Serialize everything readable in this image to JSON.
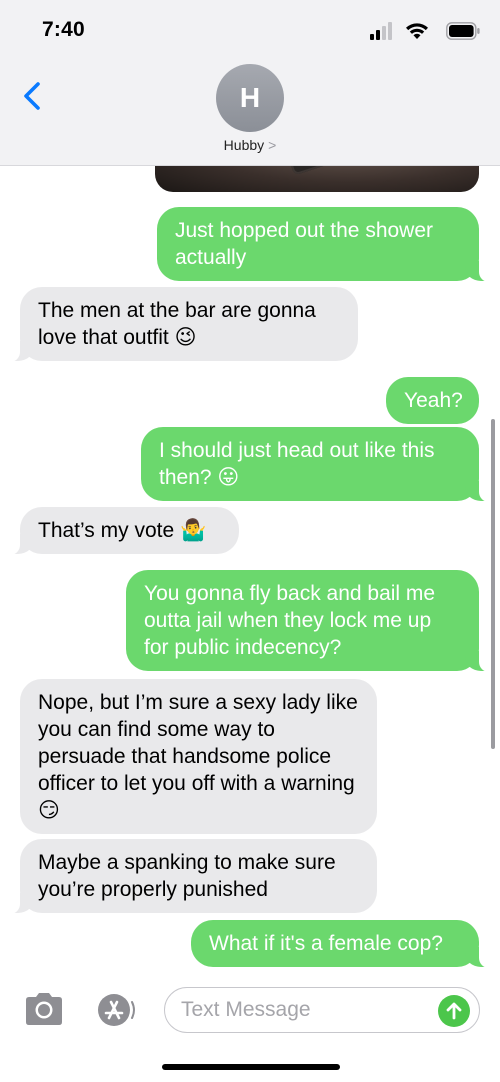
{
  "status_bar": {
    "time": "7:40",
    "icons": [
      "cellular-signal-icon",
      "wifi-icon",
      "battery-icon"
    ]
  },
  "header": {
    "avatar_initial": "H",
    "contact_name": "Hubby",
    "contact_chevron": ">",
    "back_icon": "chevron-left-icon"
  },
  "messages": [
    {
      "from": "me",
      "text": "Just hopped out the shower actually"
    },
    {
      "from": "them",
      "text": "The men at the bar are gonna love that outfit 😉"
    },
    {
      "from": "me",
      "text": "Yeah?"
    },
    {
      "from": "me",
      "text": "I should just head out like this then? 😛"
    },
    {
      "from": "them",
      "text": "That’s my vote 🤷‍♂️"
    },
    {
      "from": "me",
      "text": "You gonna fly back and bail me outta jail when they lock me up for public indecency?"
    },
    {
      "from": "them",
      "text": "Nope, but I’m sure a sexy lady like you can find some way to persuade that handsome police officer to let you off with a warning 😏"
    },
    {
      "from": "them",
      "text": "Maybe a spanking to make sure you’re properly punished"
    },
    {
      "from": "me",
      "text": "What if it's a female cop?"
    }
  ],
  "composer": {
    "placeholder": "Text Message",
    "value": ""
  },
  "colors": {
    "sent_bubble": "#6bd86d",
    "received_bubble": "#e9e9eb",
    "accent_blue": "#0a7aff",
    "send_button": "#4cc64b"
  }
}
